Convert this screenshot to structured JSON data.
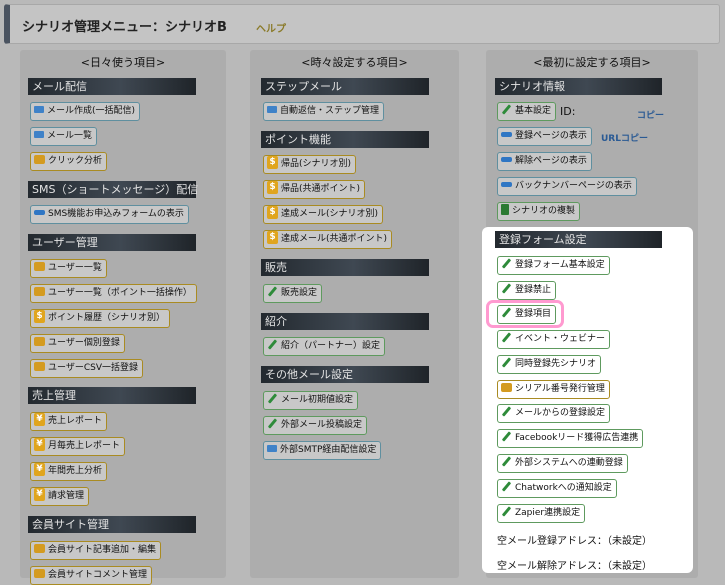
{
  "header": {
    "title": "シナリオ管理メニュー：シナリオB",
    "help": "ヘルプ"
  },
  "col1": {
    "heading": "<日々使う項目>",
    "sec_mail": "メール配信",
    "mail_create": "メール作成(一括配信)",
    "mail_list": "メール一覧",
    "click": "クリック分析",
    "sec_sms": "SMS（ショートメッセージ）配信",
    "sms_form": "SMS機能お申込みフォームの表示",
    "sec_user": "ユーザー管理",
    "user_list": "ユーザー一覧",
    "user_bulk": "ユーザー一覧（ポイント一括操作）",
    "point_hist": "ポイント履歴（シナリオ別）",
    "user_reg": "ユーザー個別登録",
    "user_csv": "ユーザーCSV一括登録",
    "sec_sales": "売上管理",
    "sales_report": "売上レポート",
    "monthly": "月毎売上レポート",
    "yearly": "年間売上分析",
    "invoice": "請求管理",
    "sec_member": "会員サイト管理",
    "member_add": "会員サイト記事追加・編集",
    "member_comment": "会員サイトコメント管理"
  },
  "col2": {
    "heading": "<時々設定する項目>",
    "sec_step": "ステップメール",
    "auto_reply": "自動返信・ステップ管理",
    "sec_point": "ポイント機能",
    "grant_scenario": "帰品(シナリオ別)",
    "grant_common": "帰品(共通ポイント)",
    "achieve_scenario": "達成メール(シナリオ別)",
    "achieve_common": "達成メール(共通ポイント)",
    "sec_sales": "販売",
    "sales_set": "販売設定",
    "sec_intro": "紹介",
    "intro_set": "紹介（パートナー）設定",
    "sec_other": "その他メール設定",
    "initial": "メール初期値設定",
    "external": "外部メール投稿設定",
    "smtp": "外部SMTP経由配信設定"
  },
  "col3": {
    "heading": "<最初に設定する項目>",
    "sec_info": "シナリオ情報",
    "basic": "基本設定",
    "id_label": "ID:",
    "copy": "コピー",
    "reg_page": "登録ページの表示",
    "url_copy": "URLコピー",
    "cancel_page": "解除ページの表示",
    "backnumber": "バックナンバーページの表示",
    "duplicate": "シナリオの複製",
    "sec_form": "登録フォーム設定",
    "form_basic": "登録フォーム基本設定",
    "reg_ban": "登録禁止",
    "reg_items": "登録項目",
    "event": "イベント・ウェビナー",
    "simul": "同時登録先シナリオ",
    "serial": "シリアル番号発行管理",
    "from_mail": "メールからの登録設定",
    "facebook": "Facebookリード獲得広告連携",
    "ext_system": "外部システムへの連動登録",
    "chatwork": "Chatworkへの通知設定",
    "zapier": "Zapier連携設定",
    "empty_reg": "空メール登録アドレス：（未設定）",
    "empty_cancel": "空メール解除アドレス：（未設定）"
  }
}
